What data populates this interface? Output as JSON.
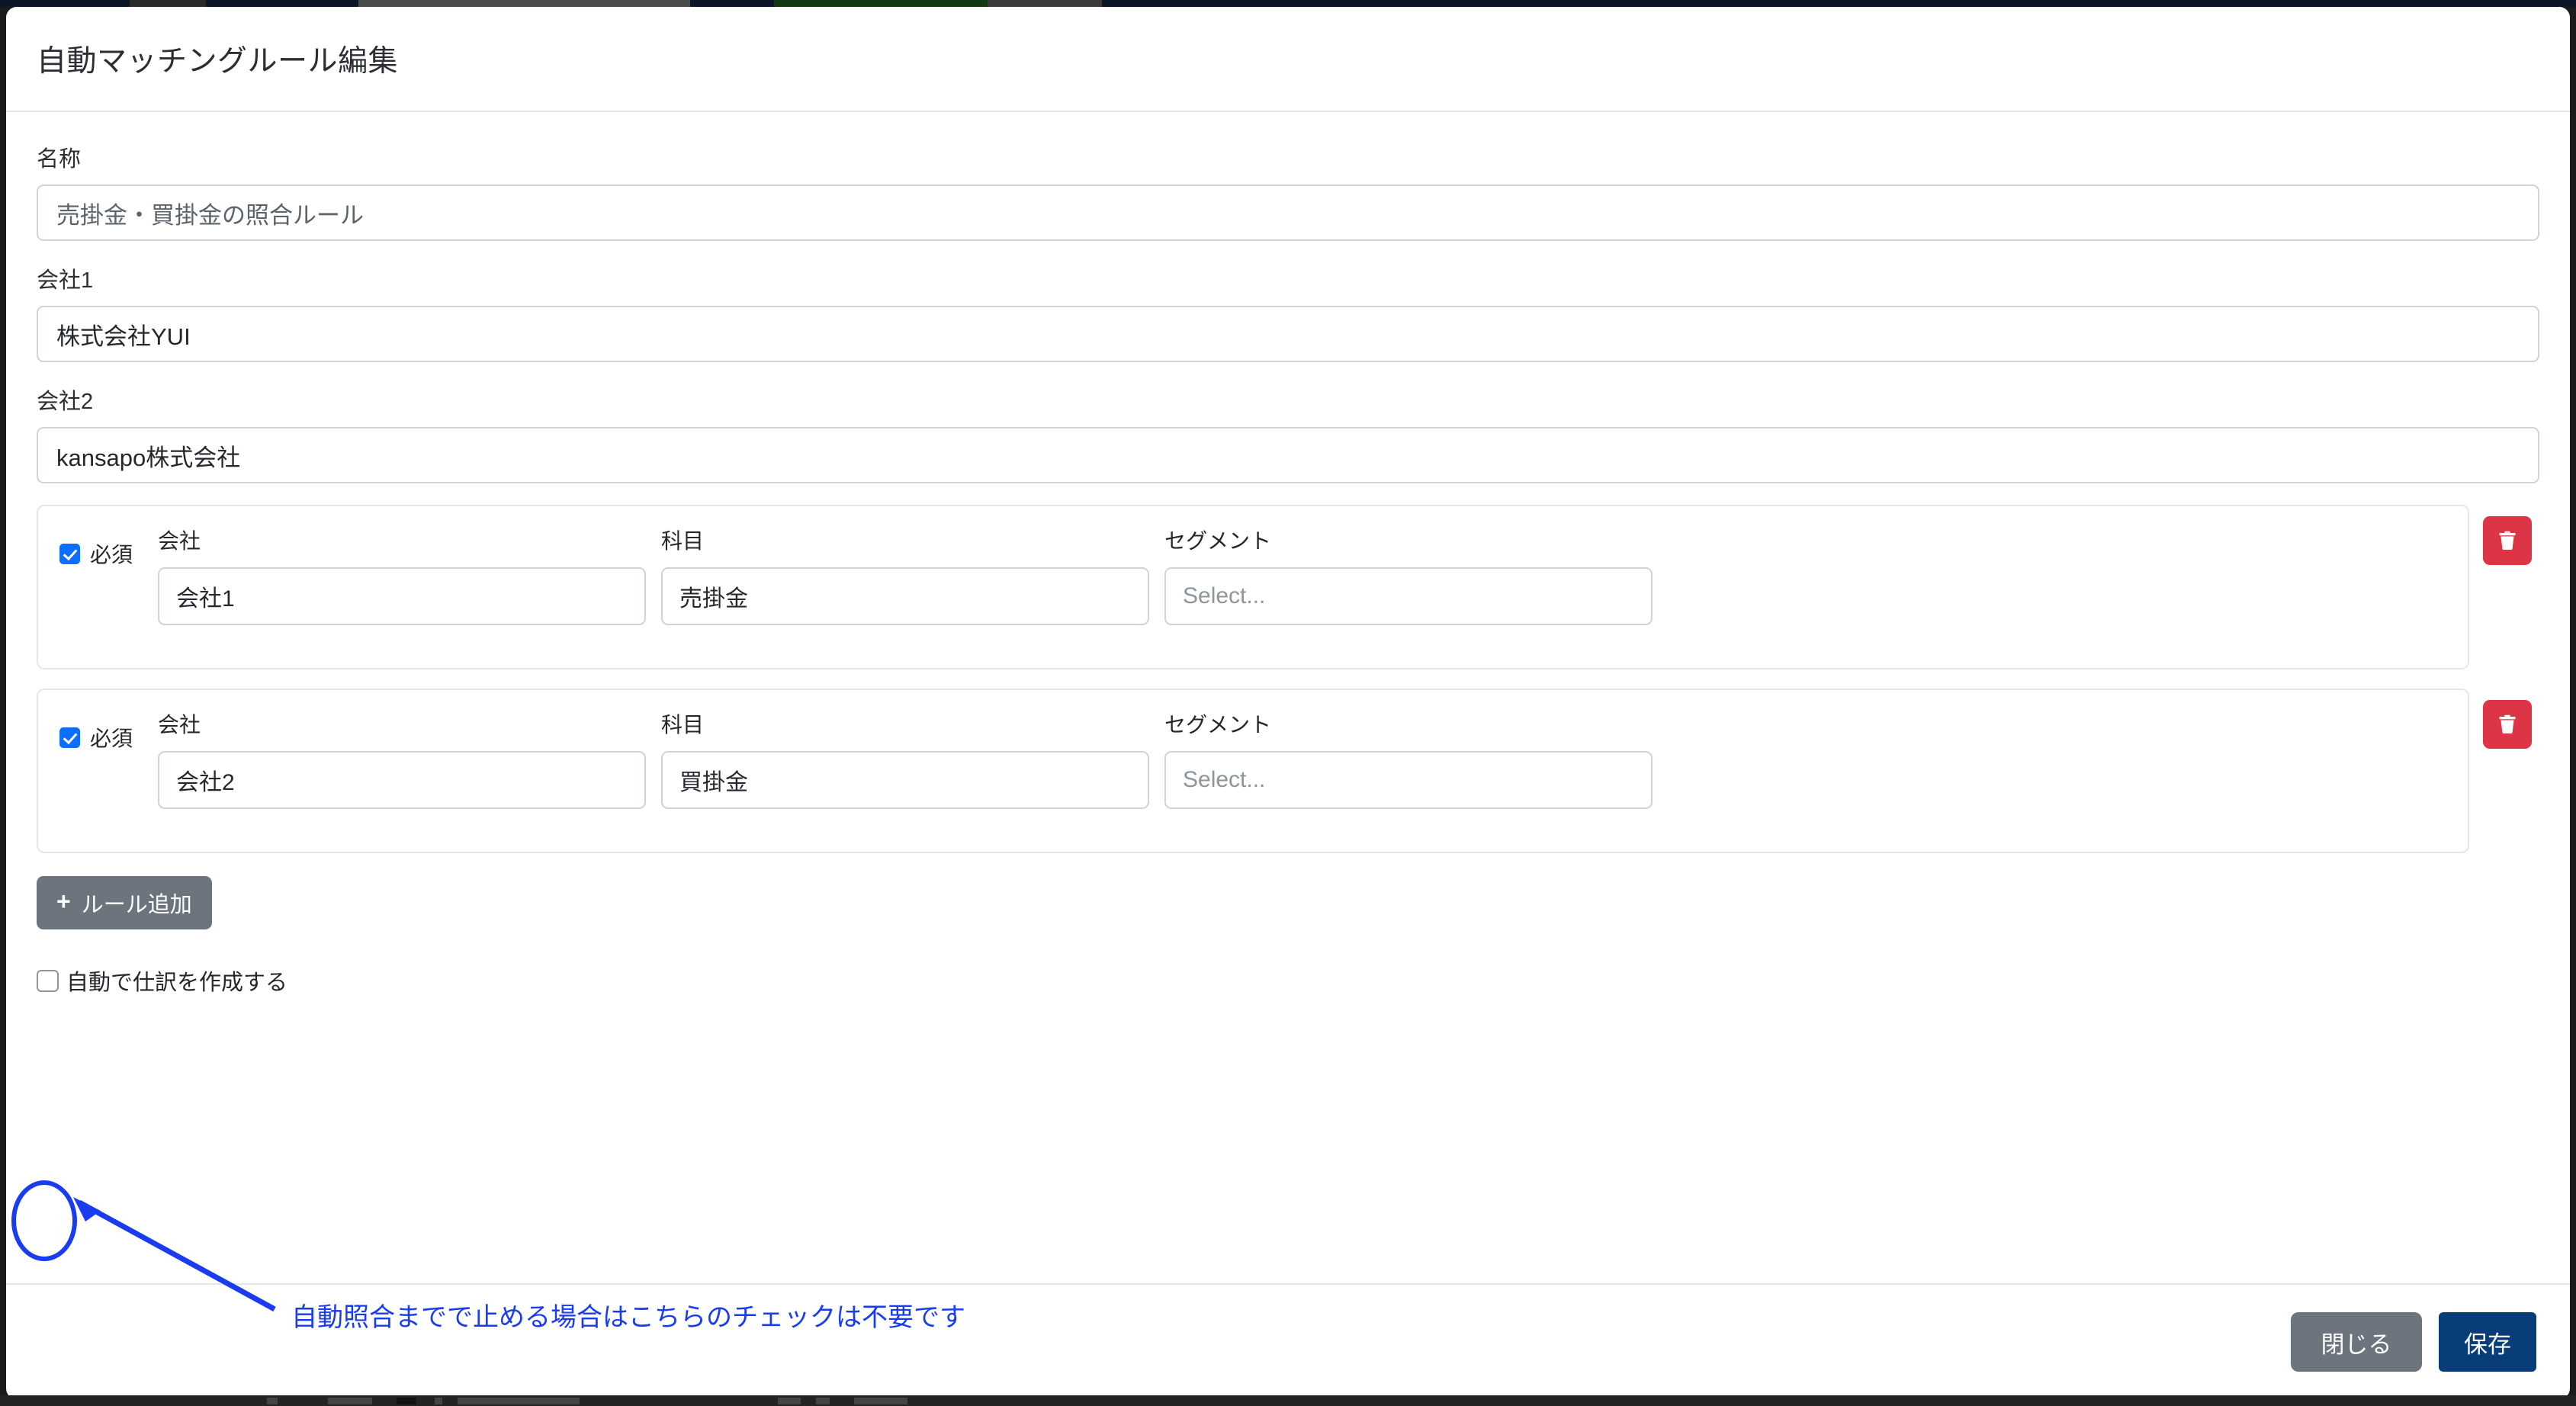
{
  "modal": {
    "title": "自動マッチングルール編集"
  },
  "form": {
    "name": {
      "label": "名称",
      "value": "売掛金・買掛金の照合ルール"
    },
    "company1": {
      "label": "会社1",
      "value": "株式会社YUI"
    },
    "company2": {
      "label": "会社2",
      "value": "kansapo株式会社"
    }
  },
  "rules": {
    "columns": {
      "required": "必須",
      "company": "会社",
      "account": "科目",
      "segment": "セグメント"
    },
    "segment_placeholder": "Select...",
    "delete_icon": "trash-icon",
    "items": [
      {
        "required": true,
        "company": "会社1",
        "account": "売掛金",
        "segment": ""
      },
      {
        "required": true,
        "company": "会社2",
        "account": "買掛金",
        "segment": ""
      }
    ]
  },
  "add_rule": {
    "icon": "plus-icon",
    "label": "ルール追加"
  },
  "auto_journal": {
    "label": "自動で仕訳を作成する",
    "checked": false
  },
  "footer": {
    "close_label": "閉じる",
    "save_label": "保存"
  },
  "annotation": {
    "text": "自動照合までで止める場合はこちらのチェックは不要です",
    "color": "#1a3cf0"
  },
  "colors": {
    "primary": "#083d7a",
    "secondary": "#6c757d",
    "danger": "#dc3545",
    "checkbox_checked": "#0d6efd",
    "border": "#ced4da",
    "annotation": "#1a3cf0"
  }
}
